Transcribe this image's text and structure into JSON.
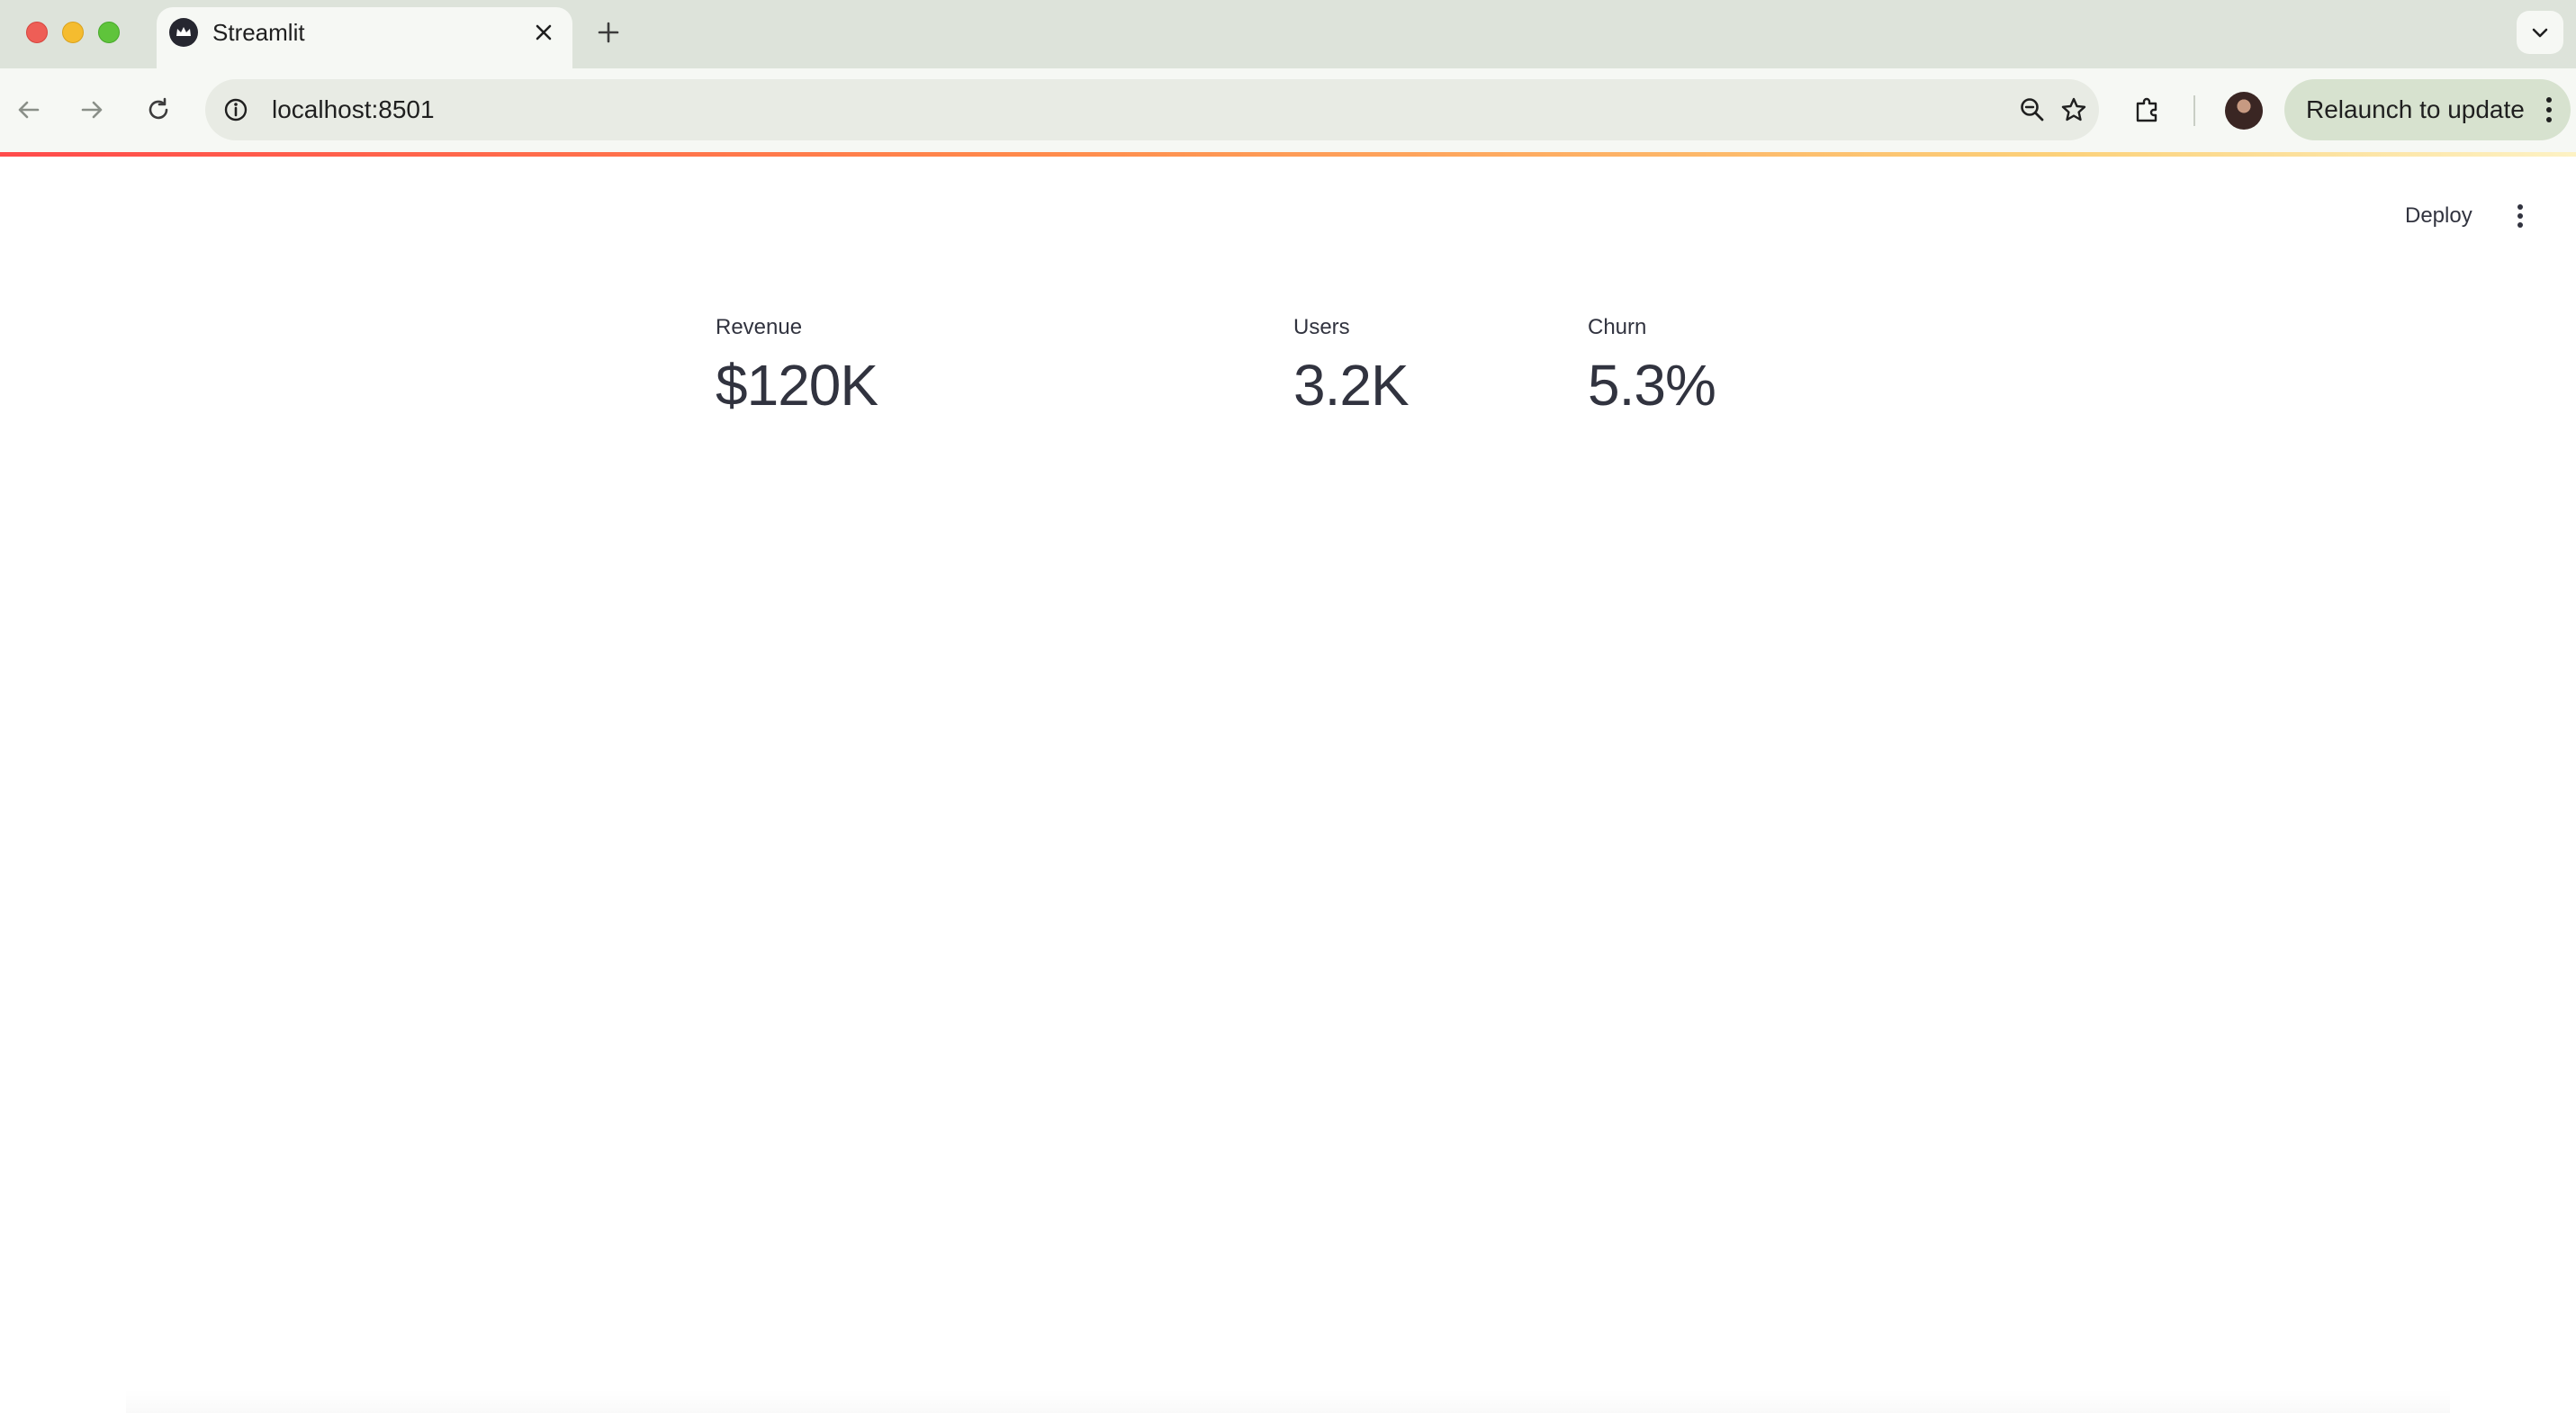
{
  "browser": {
    "tab": {
      "title": "Streamlit",
      "favicon": "streamlit-crown-icon"
    },
    "address_bar": {
      "url": "localhost:8501"
    },
    "relaunch_label": "Relaunch to update",
    "colors": {
      "chrome_bg": "#dde3da",
      "toolbar_bg": "#f6f8f4",
      "relaunch_bg": "#d7e2cf"
    }
  },
  "app": {
    "toolbar": {
      "deploy_label": "Deploy"
    },
    "metrics": [
      {
        "label": "Revenue",
        "value": "$120K"
      },
      {
        "label": "Users",
        "value": "3.2K"
      },
      {
        "label": "Churn",
        "value": "5.3%"
      }
    ],
    "colors": {
      "text": "#31333f",
      "decoration_start": "#ff4b4b",
      "decoration_end": "#fdf2c4"
    }
  }
}
